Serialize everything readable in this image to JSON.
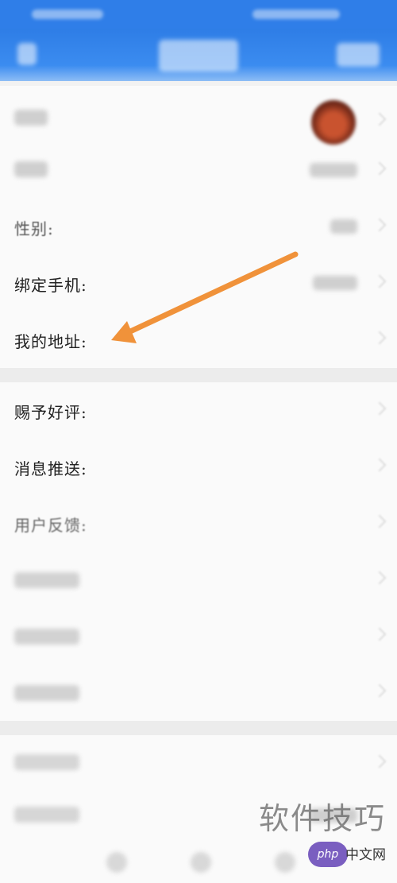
{
  "rows_section1": [
    {
      "label": "",
      "blurred": true,
      "type": "avatar"
    },
    {
      "label": "",
      "blurred": true,
      "type": "value"
    },
    {
      "label": "性别:",
      "blurred": false,
      "type": "value"
    },
    {
      "label": "绑定手机:",
      "blurred": false,
      "type": "value"
    },
    {
      "label": "我的地址:",
      "blurred": false,
      "type": "none"
    }
  ],
  "rows_section2": [
    {
      "label": "赐予好评:",
      "blurred": false
    },
    {
      "label": "消息推送:",
      "blurred": false
    },
    {
      "label": "用户反馈:",
      "blurred": false
    },
    {
      "label": "",
      "blurred": true
    },
    {
      "label": "",
      "blurred": true
    },
    {
      "label": "",
      "blurred": true
    }
  ],
  "rows_section3": [
    {
      "label": "",
      "blurred": true
    },
    {
      "label": "",
      "blurred": true
    }
  ],
  "watermark": {
    "text": "软件技巧",
    "logo": "php",
    "site": "中文网"
  },
  "colors": {
    "accent": "#2f7ee8",
    "arrow": "#f0923a"
  }
}
